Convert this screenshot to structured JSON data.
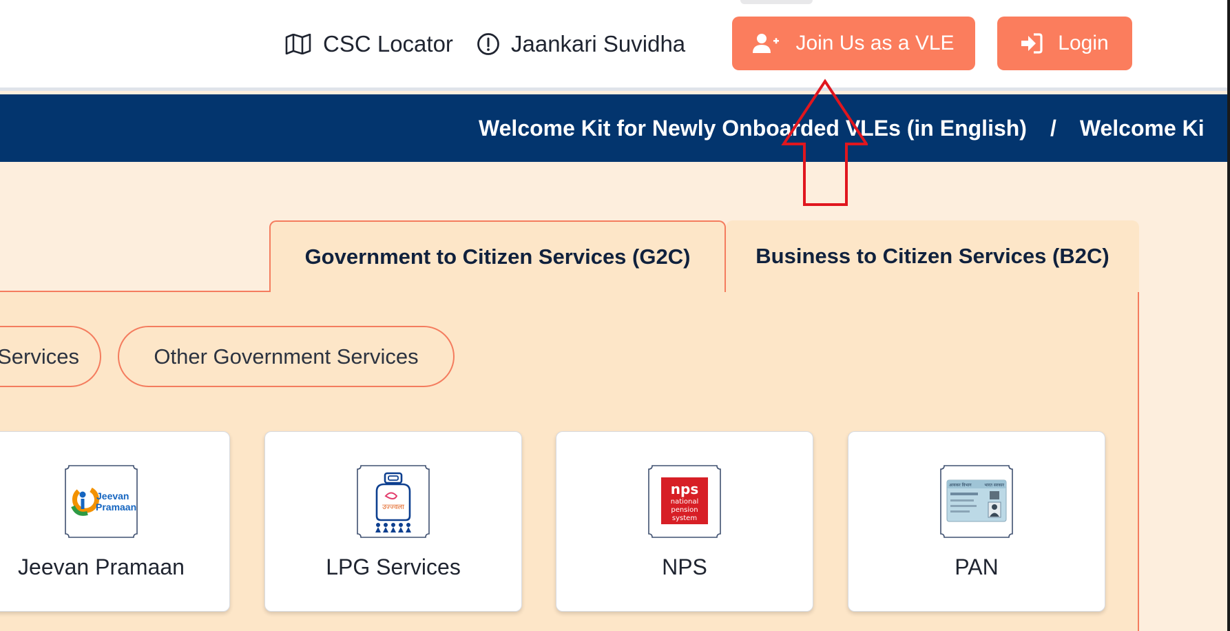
{
  "header": {
    "nav": [
      {
        "label": "CSC Locator",
        "icon": "map-icon"
      },
      {
        "label": "Jaankari Suvidha",
        "icon": "info-circle-icon"
      }
    ],
    "buttons": {
      "join_label": "Join Us as a VLE",
      "join_icon": "user-plus-icon",
      "login_label": "Login",
      "login_icon": "sign-in-icon"
    }
  },
  "ticker": {
    "item1": "Welcome Kit for Newly Onboarded VLEs (in English)",
    "separator": "/",
    "item2": "Welcome Ki"
  },
  "tabs": {
    "g2c": "Government to Citizen Services (G2C)",
    "b2c": "Business to Citizen Services (B2C)",
    "active": "g2c"
  },
  "subcategories": {
    "partial": "Services",
    "other": "Other Government Services"
  },
  "cards": [
    {
      "label": "Jeevan Pramaan",
      "logo_text": [
        "Jeevan",
        "Pramaan"
      ]
    },
    {
      "label": "LPG Services",
      "logo_text": [
        "उज्ज्वला"
      ]
    },
    {
      "label": "NPS",
      "logo_text": [
        "nps",
        "national",
        "pension",
        "system"
      ]
    },
    {
      "label": "PAN",
      "logo_text": [
        "आयकर विभाग",
        "भारत सरकार"
      ]
    }
  ],
  "colors": {
    "accent": "#fb7d5d",
    "ticker_bg": "#03356e",
    "panel_bg": "#fde6c8",
    "border": "#f47c5e",
    "page_bg": "#fdeedd",
    "annotation": "#e0161e"
  }
}
